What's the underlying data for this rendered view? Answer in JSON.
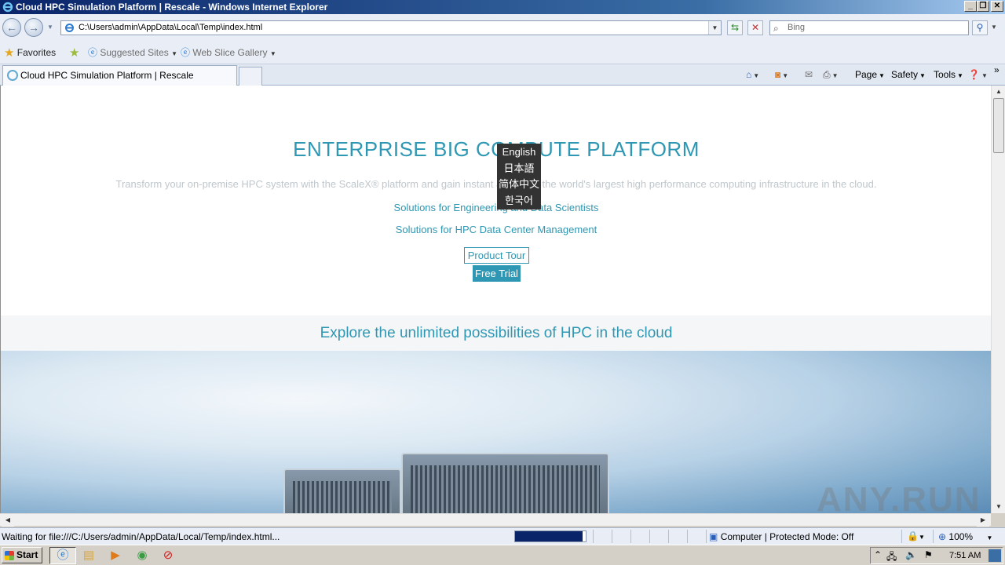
{
  "window": {
    "title": "Cloud HPC Simulation Platform | Rescale - Windows Internet Explorer"
  },
  "address_bar": {
    "url": "C:\\Users\\admin\\AppData\\Local\\Temp\\index.html"
  },
  "search": {
    "placeholder": "Bing"
  },
  "favorites_bar": {
    "favorites_label": "Favorites",
    "suggested_sites": "Suggested Sites",
    "web_slice_gallery": "Web Slice Gallery"
  },
  "tab": {
    "title": "Cloud HPC Simulation Platform | Rescale"
  },
  "command_bar": {
    "page": "Page",
    "safety": "Safety",
    "tools": "Tools"
  },
  "page": {
    "title": "ENTERPRISE BIG COMPUTE PLATFORM",
    "subtitle": "Transform your on-premise HPC system with the ScaleX® platform and gain instant access to the world's largest high performance computing infrastructure in the cloud.",
    "link_engineering": "Solutions for Engineering and Data Scientists",
    "link_hpc": "Solutions for HPC Data Center Management",
    "product_tour": "Product Tour",
    "free_trial": "Free Trial",
    "explore": "Explore the unlimited possibilities of HPC in the cloud"
  },
  "language_menu": [
    "English",
    "日本語",
    "简体中文",
    "한국어"
  ],
  "status_bar": {
    "text": "Waiting for file:///C:/Users/admin/AppData/Local/Temp/index.html...",
    "progress_fraction": 0.95,
    "zone": "Computer | Protected Mode: Off",
    "zoom": "100%"
  },
  "taskbar": {
    "start": "Start",
    "time": "7:51 AM"
  },
  "watermark": "ANY.RUN",
  "colors": {
    "accent": "#2e97b3",
    "title_bar": "#0a246a"
  }
}
